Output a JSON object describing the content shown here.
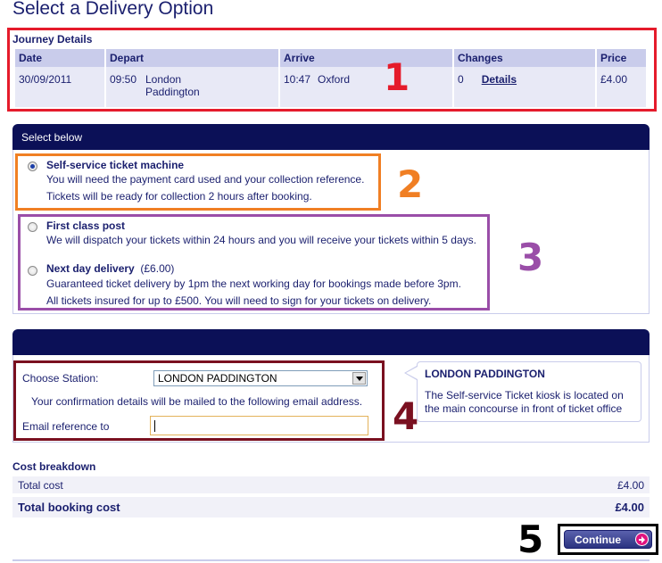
{
  "page": {
    "title": "Select a Delivery Option"
  },
  "journey": {
    "heading": "Journey Details",
    "columns": [
      "Date",
      "Depart",
      "Arrive",
      "Changes",
      "Price"
    ],
    "row": {
      "date": "30/09/2011",
      "depart_time": "09:50",
      "depart_station_line1": "London",
      "depart_station_line2": "Paddington",
      "arrive_time": "10:47",
      "arrive_station": "Oxford",
      "changes": "0",
      "details_link": "Details",
      "price": "£4.00"
    }
  },
  "delivery": {
    "heading": "Select below",
    "options": [
      {
        "title": "Self-service ticket machine",
        "extra": "",
        "lines": [
          "You will need the payment card used and your collection reference.",
          "Tickets will be ready for collection 2 hours after booking."
        ],
        "selected": true
      },
      {
        "title": "First class post",
        "extra": "",
        "lines": [
          "We will dispatch your tickets within 24 hours and you will receive your tickets within 5 days."
        ],
        "selected": false
      },
      {
        "title": "Next day delivery",
        "extra": "(£6.00)",
        "lines": [
          "Guaranteed ticket delivery by 1pm the next working day for bookings made before 3pm.",
          "All tickets insured for up to £500. You will need to sign for your tickets on delivery."
        ],
        "selected": false
      }
    ]
  },
  "collection": {
    "station_label": "Choose Station:",
    "station_value": "LONDON PADDINGTON",
    "mail_note": "Your confirmation details will be mailed to the following email address.",
    "email_label": "Email reference to",
    "email_value": "",
    "info": {
      "title": "LONDON PADDINGTON",
      "text_line1": "The Self-service Ticket kiosk is located on",
      "text_line2": "the main concourse in front of ticket office"
    }
  },
  "cost": {
    "heading": "Cost breakdown",
    "total_cost_label": "Total cost",
    "total_cost_value": "£4.00",
    "total_booking_label": "Total booking cost",
    "total_booking_value": "£4.00"
  },
  "actions": {
    "continue_label": "Continue"
  },
  "annotations": {
    "n1": "1",
    "n2": "2",
    "n3": "3",
    "n4": "4",
    "n5": "5",
    "colors": {
      "n1": "#e51b2b",
      "n2": "#f07f24",
      "n3": "#9a4ea8",
      "n4": "#7a1020",
      "n5": "#000000"
    }
  }
}
